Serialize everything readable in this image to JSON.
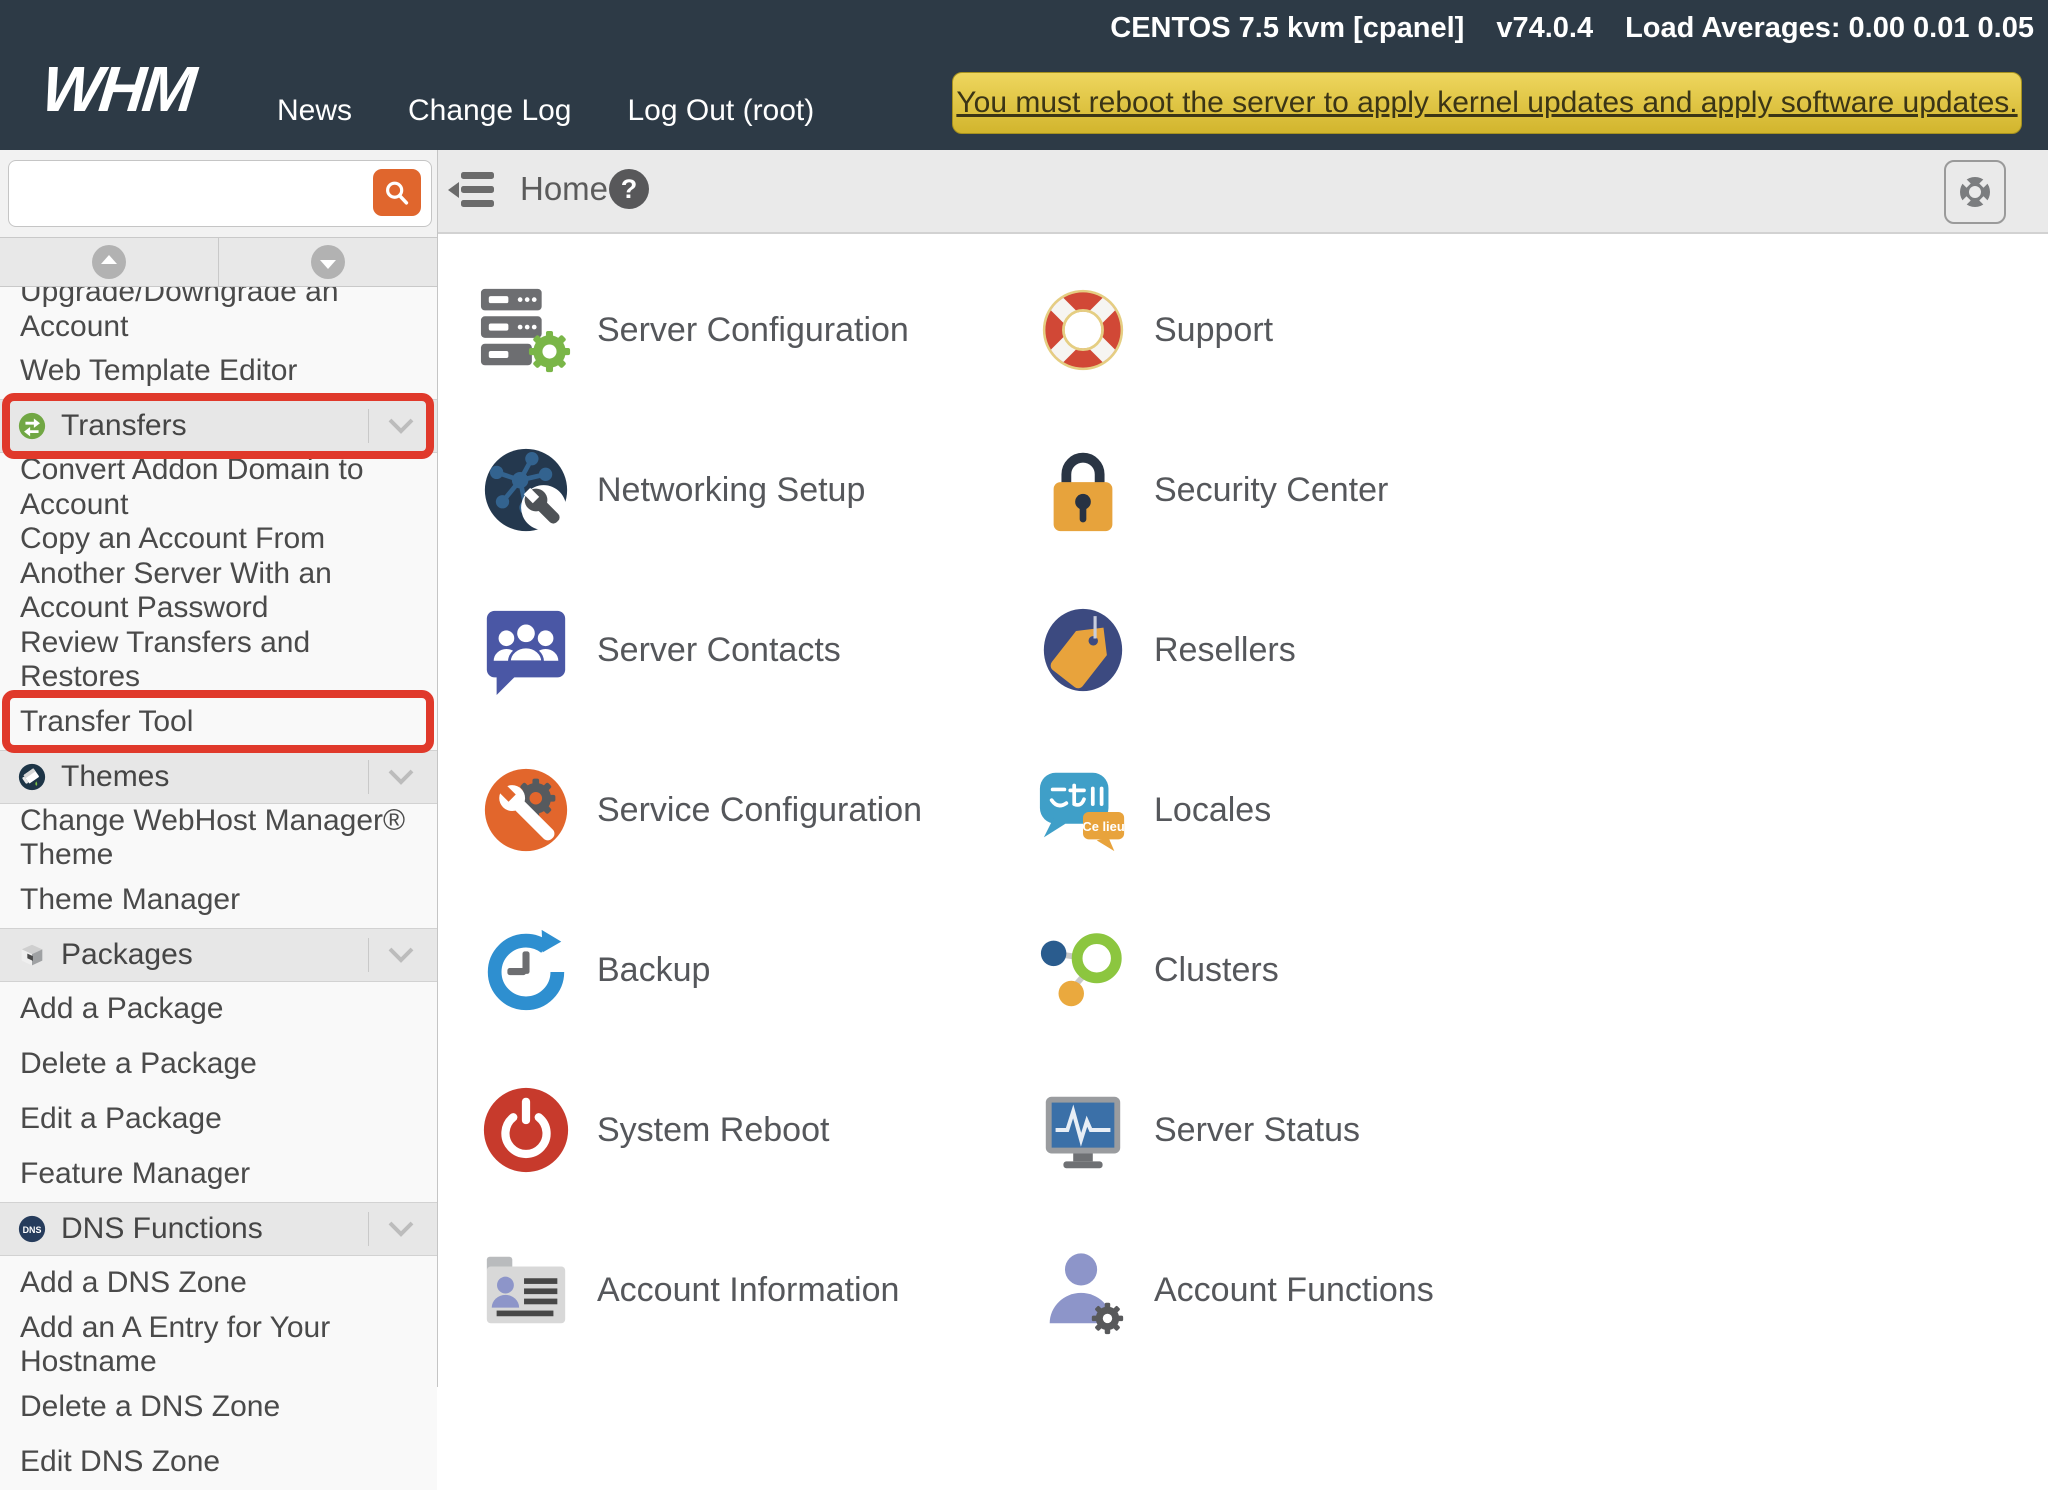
{
  "topbar": {
    "logo": "WHM",
    "nav": [
      "News",
      "Change Log",
      "Log Out (root)"
    ],
    "status": {
      "os": "CENTOS 7.5 kvm [cpanel]",
      "version": "v74.0.4",
      "load": "Load Averages: 0.00 0.01 0.05"
    },
    "banner": "You must reboot the server to apply kernel updates and apply software updates."
  },
  "sidebar": {
    "search": {
      "value": "",
      "placeholder": ""
    },
    "menu": [
      {
        "type": "item",
        "label": "Upgrade/Downgrade an Account"
      },
      {
        "type": "item",
        "label": "Web Template Editor"
      },
      {
        "type": "header",
        "label": "Transfers",
        "icon": "transfers-icon",
        "highlighted": true
      },
      {
        "type": "item",
        "label": "Convert Addon Domain to Account"
      },
      {
        "type": "item",
        "label": "Copy an Account From Another Server With an Account Password",
        "two_line": true
      },
      {
        "type": "item",
        "label": "Review Transfers and Restores"
      },
      {
        "type": "item",
        "label": "Transfer Tool",
        "highlighted": true
      },
      {
        "type": "header",
        "label": "Themes",
        "icon": "themes-icon"
      },
      {
        "type": "item",
        "label": "Change WebHost Manager® Theme"
      },
      {
        "type": "item",
        "label": "Theme Manager"
      },
      {
        "type": "header",
        "label": "Packages",
        "icon": "packages-icon"
      },
      {
        "type": "item",
        "label": "Add a Package"
      },
      {
        "type": "item",
        "label": "Delete a Package"
      },
      {
        "type": "item",
        "label": "Edit a Package"
      },
      {
        "type": "item",
        "label": "Feature Manager"
      },
      {
        "type": "header",
        "label": "DNS Functions",
        "icon": "dns-icon"
      },
      {
        "type": "item",
        "label": "Add a DNS Zone"
      },
      {
        "type": "item",
        "label": "Add an A Entry for Your Hostname"
      },
      {
        "type": "item",
        "label": "Delete a DNS Zone"
      },
      {
        "type": "item",
        "label": "Edit DNS Zone"
      }
    ]
  },
  "breadcrumb": {
    "title": "Home"
  },
  "main": {
    "tiles": [
      {
        "label": "Server Configuration",
        "icon": "server-configuration-icon"
      },
      {
        "label": "Support",
        "icon": "support-icon"
      },
      {
        "label": "Networking Setup",
        "icon": "networking-setup-icon"
      },
      {
        "label": "Security Center",
        "icon": "security-center-icon"
      },
      {
        "label": "Server Contacts",
        "icon": "server-contacts-icon"
      },
      {
        "label": "Resellers",
        "icon": "resellers-icon"
      },
      {
        "label": "Service Configuration",
        "icon": "service-configuration-icon"
      },
      {
        "label": "Locales",
        "icon": "locales-icon"
      },
      {
        "label": "Backup",
        "icon": "backup-icon"
      },
      {
        "label": "Clusters",
        "icon": "clusters-icon"
      },
      {
        "label": "System Reboot",
        "icon": "system-reboot-icon"
      },
      {
        "label": "Server Status",
        "icon": "server-status-icon"
      },
      {
        "label": "Account Information",
        "icon": "account-information-icon"
      },
      {
        "label": "Account Functions",
        "icon": "account-functions-icon"
      }
    ]
  },
  "colors": {
    "topbar_bg": "#2d3a46",
    "accent_orange": "#e0662d",
    "banner_bg": "#e3c643",
    "annotation_red": "#e0392b",
    "sidebar_header_bg": "#e7e7e7",
    "breadcrumb_bg": "#eaeaea"
  }
}
